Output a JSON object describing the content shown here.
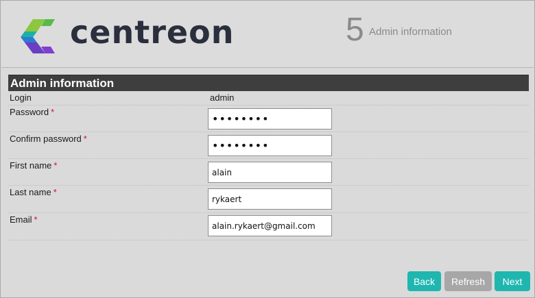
{
  "header": {
    "logo_text": "centreon",
    "step_number": "5",
    "step_label": "Admin information"
  },
  "section": {
    "title": "Admin information"
  },
  "form": {
    "login": {
      "label": "Login",
      "value": "admin"
    },
    "password": {
      "label": "Password",
      "required_mark": "*",
      "value": "••••••••"
    },
    "confirm_password": {
      "label": "Confirm password",
      "required_mark": "*",
      "value": "••••••••"
    },
    "first_name": {
      "label": "First name",
      "required_mark": "*",
      "value": "alain"
    },
    "last_name": {
      "label": "Last name",
      "required_mark": "*",
      "value": "rykaert"
    },
    "email": {
      "label": "Email",
      "required_mark": "*",
      "value": "alain.rykaert@gmail.com"
    }
  },
  "buttons": {
    "back": "Back",
    "refresh": "Refresh",
    "next": "Next"
  },
  "colors": {
    "accent": "#1fb6b0",
    "disabled": "#a7a7a7",
    "section_bar": "#3e3e3e",
    "required": "#d10e2f"
  }
}
